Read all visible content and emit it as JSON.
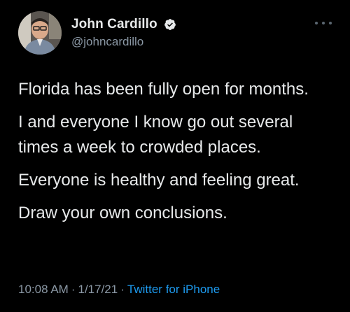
{
  "author": {
    "display_name": "John Cardillo",
    "handle": "@johncardillo",
    "verified": true
  },
  "tweet": {
    "paragraphs": [
      "Florida has been fully open for months.",
      "I and everyone I know go out several times a week to crowded places.",
      "Everyone is healthy and feeling great.",
      "Draw your own conclusions."
    ],
    "time": "10:08 AM",
    "date": "1/17/21",
    "separator": "·",
    "source": "Twitter for iPhone"
  },
  "icons": {
    "verified": "verified-badge-icon",
    "more": "more-options-icon"
  },
  "colors": {
    "background": "#000000",
    "primary_text": "#e7e9ea",
    "secondary_text": "#8b98a5",
    "link": "#1d9bf0"
  }
}
